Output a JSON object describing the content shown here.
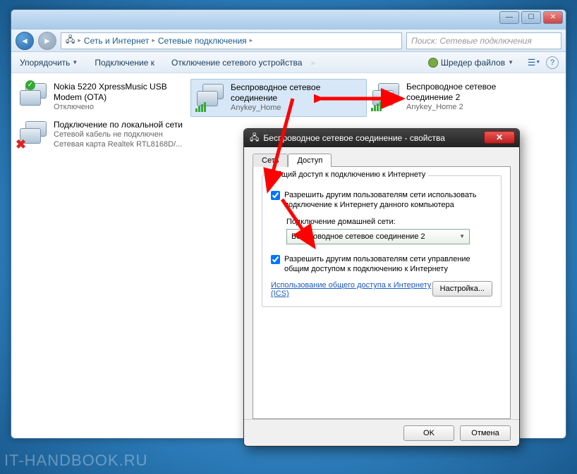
{
  "explorer": {
    "breadcrumbs": [
      "Сеть и Интернет",
      "Сетевые подключения"
    ],
    "search_placeholder": "Поиск: Сетевые подключения",
    "toolbar": {
      "organize": "Упорядочить",
      "connect": "Подключение к",
      "disable": "Отключение сетевого устройства",
      "shredder": "Шредер файлов"
    },
    "connections": [
      {
        "name": "Nokia 5220 XpressMusic USB Modem (OTA)",
        "sub1": "Отключено",
        "sub2": ""
      },
      {
        "name": "Беспроводное сетевое соединение",
        "sub1": "Anykey_Home",
        "sub2": ""
      },
      {
        "name": "Беспроводное сетевое соединение 2",
        "sub1": "Anykey_Home 2",
        "sub2": ""
      },
      {
        "name": "Подключение по локальной сети",
        "sub1": "Сетевой кабель не подключен",
        "sub2": "Сетевая карта Realtek RTL8168D/..."
      }
    ]
  },
  "dialog": {
    "title": "Беспроводное сетевое соединение - свойства",
    "tab_net": "Сеть",
    "tab_share": "Доступ",
    "group_title": "Общий доступ к подключению к Интернету",
    "chk1": "Разрешить другим пользователям сети использовать подключение к Интернету данного компьютера",
    "home_net_label": "Подключение домашней сети:",
    "combo_value": "Беспроводное сетевое соединение 2",
    "chk2": "Разрешить другим пользователям сети управление общим доступом к подключению к Интернету",
    "link_text": "Использование общего доступа к Интернету (ICS)",
    "settings_btn": "Настройка...",
    "ok": "OK",
    "cancel": "Отмена"
  },
  "watermark": "IT-HANDBOOK.RU"
}
